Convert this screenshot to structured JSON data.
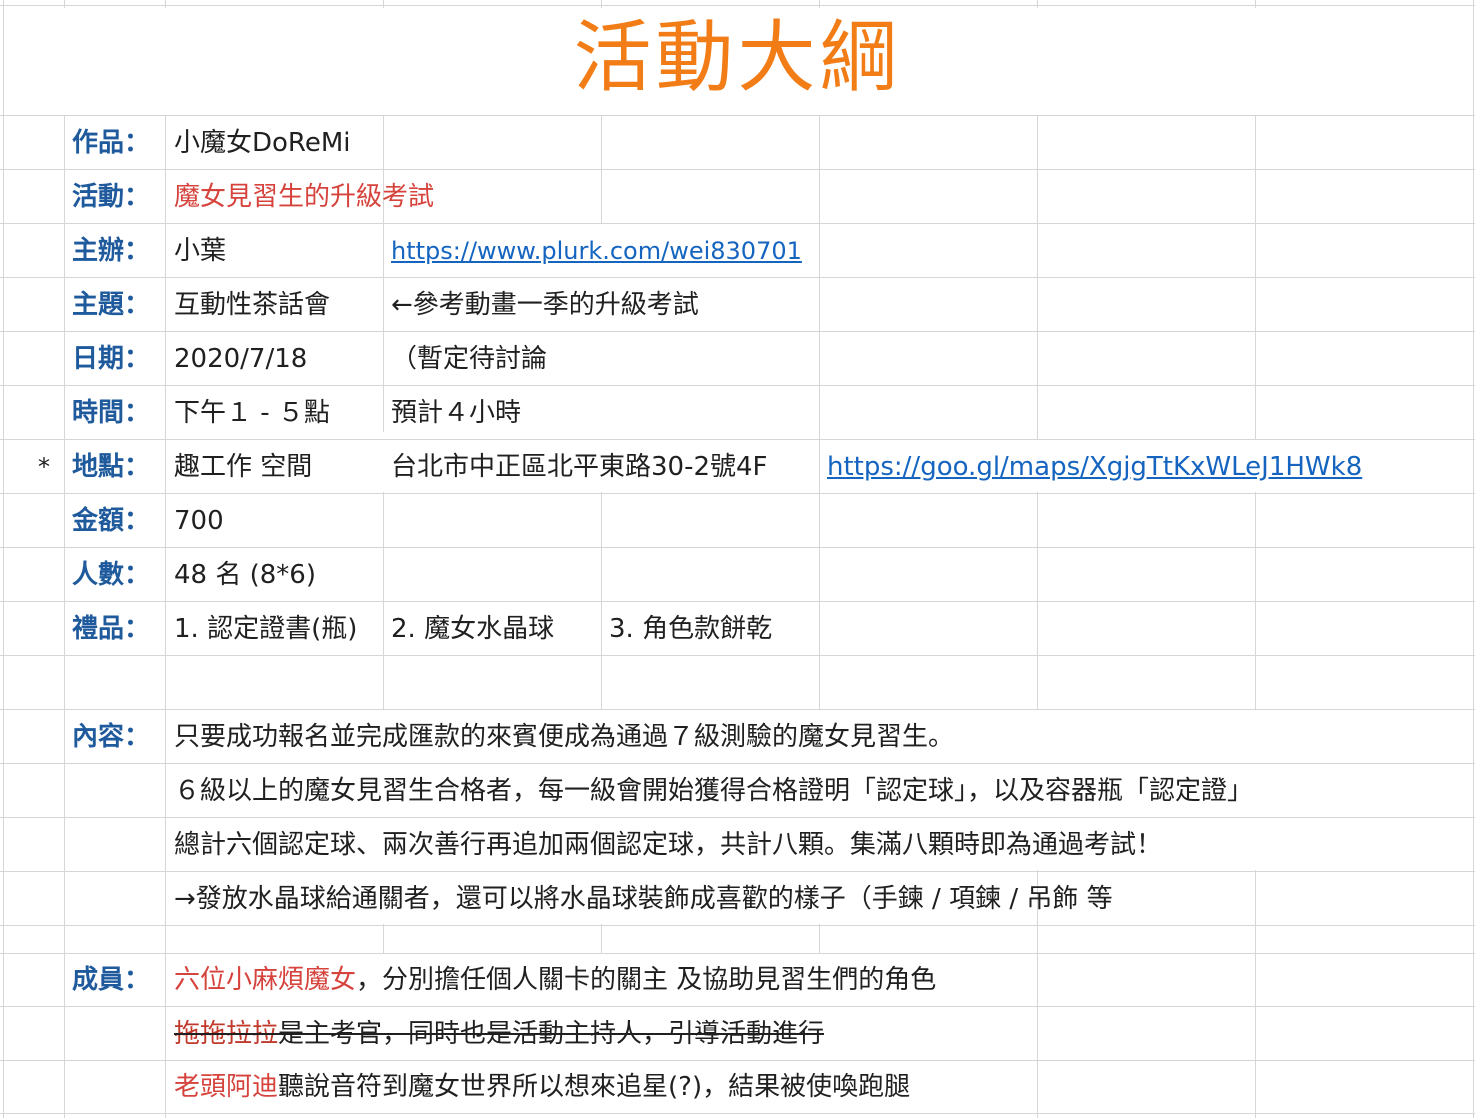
{
  "title": "活動大綱",
  "rows": {
    "work": {
      "label": "作品：",
      "value": "小魔女DoReMi"
    },
    "event": {
      "label": "活動：",
      "value": "魔女見習生的升級考試"
    },
    "host": {
      "label": "主辦：",
      "value": "小葉",
      "link": "https://www.plurk.com/wei830701"
    },
    "theme": {
      "label": "主題：",
      "value": "互動性茶話會",
      "note": "←參考動畫一季的升級考試"
    },
    "date": {
      "label": "日期：",
      "value": "2020/7/18",
      "note": "（暫定待討論"
    },
    "time": {
      "label": "時間：",
      "value": "下午１ - ５點",
      "note": "預計４小時"
    },
    "place": {
      "marker": "*",
      "label": "地點：",
      "value": "趣工作 空間",
      "address": "台北市中正區北平東路30-2號4F",
      "link": "https://goo.gl/maps/XgjgTtKxWLeJ1HWk8"
    },
    "fee": {
      "label": "金額：",
      "value": "700"
    },
    "people": {
      "label": "人數：",
      "value": "48 名 (8*6)"
    },
    "gifts": {
      "label": "禮品：",
      "items": [
        "1. 認定證書(瓶)",
        "2. 魔女水晶球",
        "3. 角色款餅乾"
      ]
    }
  },
  "content": {
    "label": "內容：",
    "lines": [
      "只要成功報名並完成匯款的來賓便成為通過７級測驗的魔女見習生。",
      "６級以上的魔女見習生合格者，每一級會開始獲得合格證明「認定球」，以及容器瓶「認定證」",
      "總計六個認定球、兩次善行再追加兩個認定球，共計八顆。集滿八顆時即為通過考試！",
      "→發放水晶球給通關者，還可以將水晶球裝飾成喜歡的樣子（手鍊 / 項鍊 / 吊飾 等"
    ]
  },
  "members": {
    "label": "成員：",
    "line1": {
      "red": "六位小麻煩魔女",
      "rest": "，分別擔任個人關卡的關主 及協助見習生們的角色"
    },
    "line2": {
      "red": "拖拖拉拉",
      "rest": "是主考官，同時也是活動主持人，引導活動進行"
    },
    "line3": {
      "red": "老頭阿迪",
      "rest": "聽說音符到魔女世界所以想來追星(?)，結果被使喚跑腿"
    }
  },
  "colors": {
    "title": "#f27c16",
    "label": "#1f5a9c",
    "accent_red": "#d6433c",
    "link": "#1565c0",
    "grid": "#d6d6d6"
  }
}
